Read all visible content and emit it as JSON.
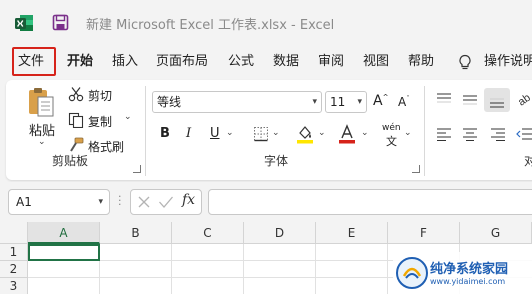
{
  "title_bar": {
    "title": "新建 Microsoft Excel 工作表.xlsx  -  Excel"
  },
  "tabs": [
    {
      "label": "文件",
      "name": "tab-file"
    },
    {
      "label": "开始",
      "name": "tab-home"
    },
    {
      "label": "插入",
      "name": "tab-insert"
    },
    {
      "label": "页面布局",
      "name": "tab-page-layout"
    },
    {
      "label": "公式",
      "name": "tab-formulas"
    },
    {
      "label": "数据",
      "name": "tab-data"
    },
    {
      "label": "审阅",
      "name": "tab-review"
    },
    {
      "label": "视图",
      "name": "tab-view"
    },
    {
      "label": "帮助",
      "name": "tab-help"
    }
  ],
  "tell_me": {
    "label": "操作说明"
  },
  "clipboard": {
    "paste_label": "粘贴",
    "cut_label": "剪切",
    "copy_label": "复制",
    "format_painter_label": "格式刷",
    "group_label": "剪贴板"
  },
  "font": {
    "font_name": "等线",
    "font_size": "11",
    "bold": "B",
    "italic": "I",
    "underline": "U",
    "group_label": "字体",
    "phonetic_label": "wén"
  },
  "alignment": {
    "group_label_partial": "对"
  },
  "formula_bar": {
    "name_box": "A1",
    "fx_label": "fx",
    "formula_value": ""
  },
  "grid": {
    "columns": [
      "A",
      "B",
      "C",
      "D",
      "E",
      "F",
      "G"
    ],
    "rows": [
      "1",
      "2",
      "3"
    ]
  },
  "watermark": {
    "text": "纯净系统家园",
    "url": "www.yidaimei.com"
  },
  "colors": {
    "excel_green": "#217346",
    "file_highlight": "#d6231a",
    "fill_yellow": "#ffe600",
    "font_red": "#d6231a"
  },
  "icons": [
    "excel-logo-icon",
    "save-icon",
    "lightbulb-icon",
    "paste-icon",
    "scissors-icon",
    "copy-icon",
    "format-painter-icon",
    "border-icon",
    "fill-color-icon",
    "font-color-icon",
    "phonetic-icon",
    "increase-font-icon",
    "decrease-font-icon",
    "align-top-icon",
    "align-middle-icon",
    "align-bottom-icon",
    "align-left-icon",
    "align-center-icon",
    "align-right-icon",
    "orientation-icon",
    "indent-icon",
    "cancel-icon",
    "enter-icon",
    "insert-function-icon"
  ]
}
